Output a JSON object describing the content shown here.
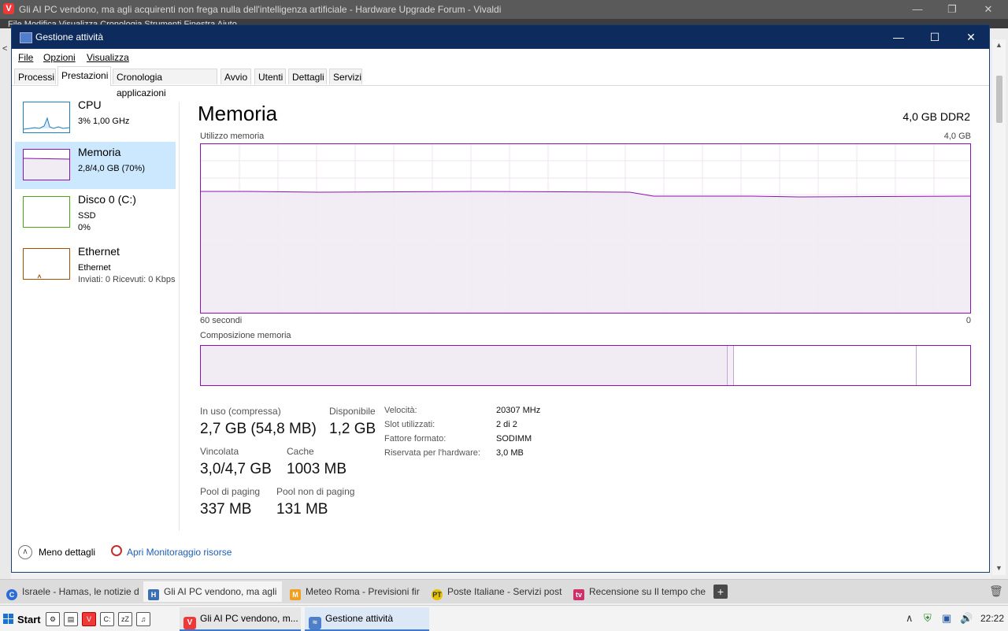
{
  "browser": {
    "title": "Gli AI PC vendono, ma agli acquirenti non frega nulla dell'intelligenza artificiale - Hardware Upgrade Forum - Vivaldi",
    "logo_letter": "V",
    "menu_text": "File  Modifica  Visualizza  Cronologia  Strumenti  Finestra  Aiuto",
    "side_char": "<",
    "tabs": [
      {
        "label": "Israele - Hamas, le notizie d",
        "icon": "C",
        "color": "#2d6bd5"
      },
      {
        "label": "Gli AI PC vendono, ma agli",
        "icon": "H",
        "color": "#3b6fb0"
      },
      {
        "label": "Meteo Roma - Previsioni fir",
        "icon": "M",
        "color": "#f0a020"
      },
      {
        "label": "Poste Italiane - Servizi post",
        "icon": "PT",
        "color": "#e8c400"
      },
      {
        "label": "Recensione su Il tempo che",
        "icon": "tv",
        "color": "#d0306a"
      }
    ],
    "newtab": "+"
  },
  "taskbar": {
    "start": "Start",
    "quicklaunch": [
      "⚙",
      "▤",
      "V",
      "C:",
      "zZ",
      "♫"
    ],
    "tasks": [
      {
        "label": "Gli AI PC vendono, m...",
        "icon": "V",
        "color": "#ef3939"
      },
      {
        "label": "Gestione attività",
        "icon": "≈",
        "color": "#4f7fc8"
      }
    ],
    "clock": "22:22"
  },
  "window": {
    "title": "Gestione attività",
    "menu": [
      "File",
      "Opzioni",
      "Visualizza"
    ],
    "tabs": [
      "Processi",
      "Prestazioni",
      "Cronologia applicazioni",
      "Avvio",
      "Utenti",
      "Dettagli",
      "Servizi"
    ],
    "active_tab": "Prestazioni"
  },
  "sidebar": [
    {
      "name": "CPU",
      "sub1": "3%  1,00 GHz",
      "sub2": "",
      "color": "#1c7fbf",
      "selected": false
    },
    {
      "name": "Memoria",
      "sub1": "2,8/4,0 GB (70%)",
      "sub2": "",
      "color": "#8b12ae",
      "selected": true
    },
    {
      "name": "Disco 0 (C:)",
      "sub1": "SSD",
      "sub2": "0%",
      "color": "#4da60c",
      "selected": false
    },
    {
      "name": "Ethernet",
      "sub1": "Ethernet",
      "sub2": "Inviati: 0  Ricevuti: 0 Kbps",
      "color": "#a74f01",
      "selected": false
    }
  ],
  "main": {
    "title": "Memoria",
    "spec": "4,0 GB DDR2",
    "graph_label": "Utilizzo memoria",
    "graph_max": "4,0 GB",
    "time_left": "60 secondi",
    "time_right": "0",
    "composition_label": "Composizione memoria",
    "usage_fraction": 0.7,
    "composition": {
      "in_use_fraction": 0.683,
      "modified_fraction": 0.008,
      "standby_fraction": 0.238
    }
  },
  "stats": {
    "in_uso_label": "In uso (compressa)",
    "in_uso_value": "2,7 GB (54,8 MB)",
    "disponibile_label": "Disponibile",
    "disponibile_value": "1,2 GB",
    "vincolata_label": "Vincolata",
    "vincolata_value": "3,0/4,7 GB",
    "cache_label": "Cache",
    "cache_value": "1003 MB",
    "paging_label": "Pool di paging",
    "paging_value": "337 MB",
    "nonpaging_label": "Pool non di paging",
    "nonpaging_value": "131 MB"
  },
  "details": {
    "velocita_k": "Velocità:",
    "velocita_v": "20307 MHz",
    "slot_k": "Slot utilizzati:",
    "slot_v": "2 di 2",
    "fattore_k": "Fattore formato:",
    "fattore_v": "SODIMM",
    "riservata_k": "Riservata per l'hardware:",
    "riservata_v": "3,0 MB"
  },
  "footer": {
    "less_details": "Meno dettagli",
    "monitor_link": "Apri Monitoraggio risorse"
  }
}
